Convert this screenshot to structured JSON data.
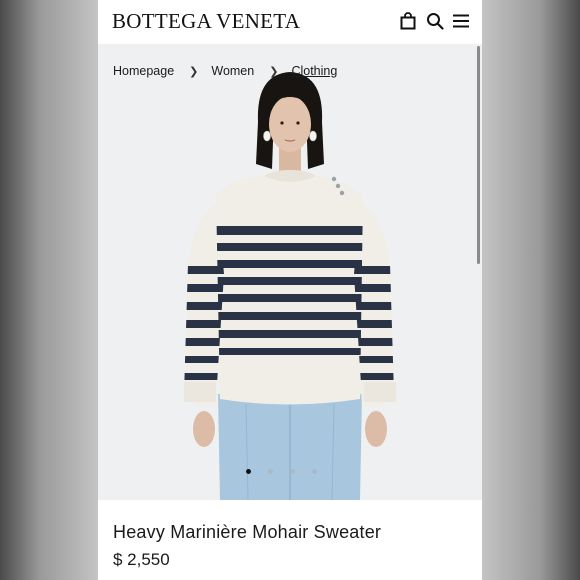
{
  "header": {
    "brand": "BOTTEGA VENETA",
    "icons": [
      "bag-icon",
      "search-icon",
      "menu-icon"
    ]
  },
  "breadcrumb": {
    "items": [
      "Homepage",
      "Women",
      "Clothing"
    ]
  },
  "gallery": {
    "slide_count": 4,
    "active_slide": 1
  },
  "product": {
    "name": "Heavy Marinière Mohair Sweater",
    "price": "$ 2,550"
  },
  "colors": {
    "sweater": "#f1eee7",
    "stripe": "#2a3246",
    "jeans": "#a9c6df",
    "background": "#eef0f2"
  }
}
